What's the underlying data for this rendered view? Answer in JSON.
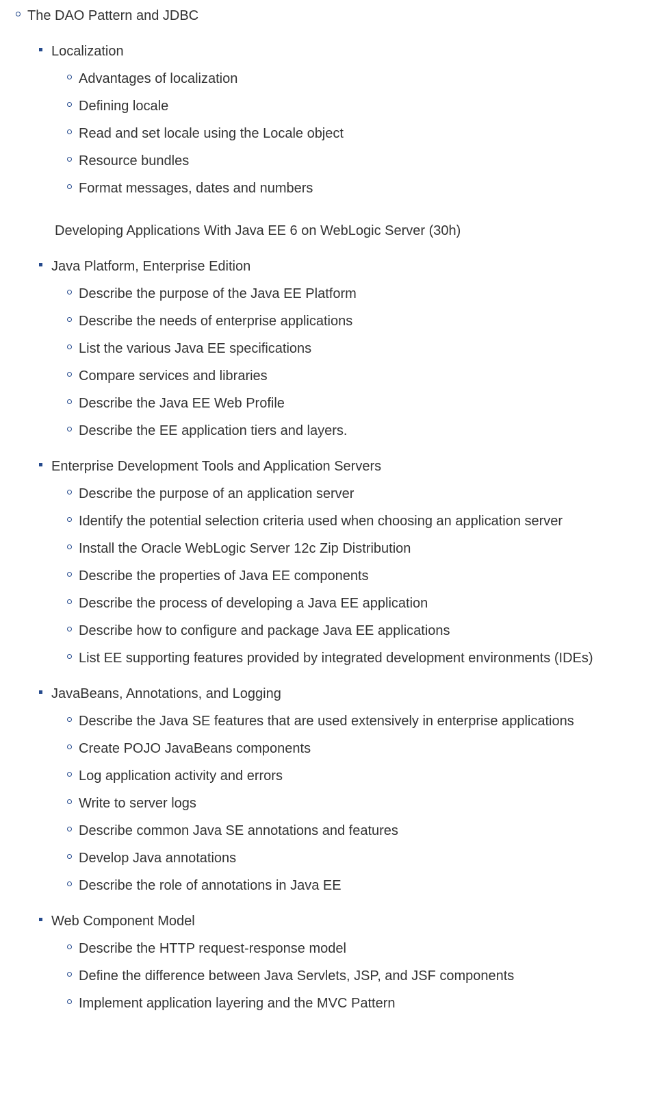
{
  "initial_sub": [
    "The DAO Pattern and JDBC"
  ],
  "sections_before_heading": [
    {
      "title": "Localization",
      "items": [
        "Advantages of localization",
        "Defining locale",
        "Read and set locale using the Locale object",
        "Resource bundles",
        "Format messages, dates and numbers"
      ]
    }
  ],
  "heading": "Developing Applications With Java EE 6 on WebLogic Server (30h)",
  "sections_after_heading": [
    {
      "title": "Java Platform, Enterprise Edition",
      "items": [
        "Describe the purpose of the Java EE Platform",
        "Describe the needs of enterprise applications",
        "List the various Java EE specifications",
        "Compare services and libraries",
        "Describe the Java EE Web Profile",
        "Describe the EE application tiers and layers."
      ]
    },
    {
      "title": "Enterprise Development Tools and Application Servers",
      "items": [
        "Describe the purpose of an application server",
        "Identify the potential selection criteria used when choosing an application server",
        "Install the Oracle WebLogic Server 12c Zip Distribution",
        "Describe the properties of Java EE components",
        "Describe the process of developing a Java EE application",
        "Describe how to configure and package Java EE applications",
        "List EE supporting features provided by integrated development environments (IDEs)"
      ]
    },
    {
      "title": "JavaBeans, Annotations, and Logging",
      "items": [
        "Describe the Java SE features that are used extensively in enterprise applications",
        "Create POJO JavaBeans components",
        "Log application activity and errors",
        "Write to server logs",
        "Describe common Java SE annotations and features",
        "Develop Java annotations",
        "Describe the role of annotations in Java EE"
      ]
    },
    {
      "title": "Web Component Model",
      "items": [
        "Describe the HTTP request-response model",
        "Define the difference between Java Servlets, JSP, and JSF components",
        "Implement application layering and the MVC Pattern"
      ]
    }
  ]
}
